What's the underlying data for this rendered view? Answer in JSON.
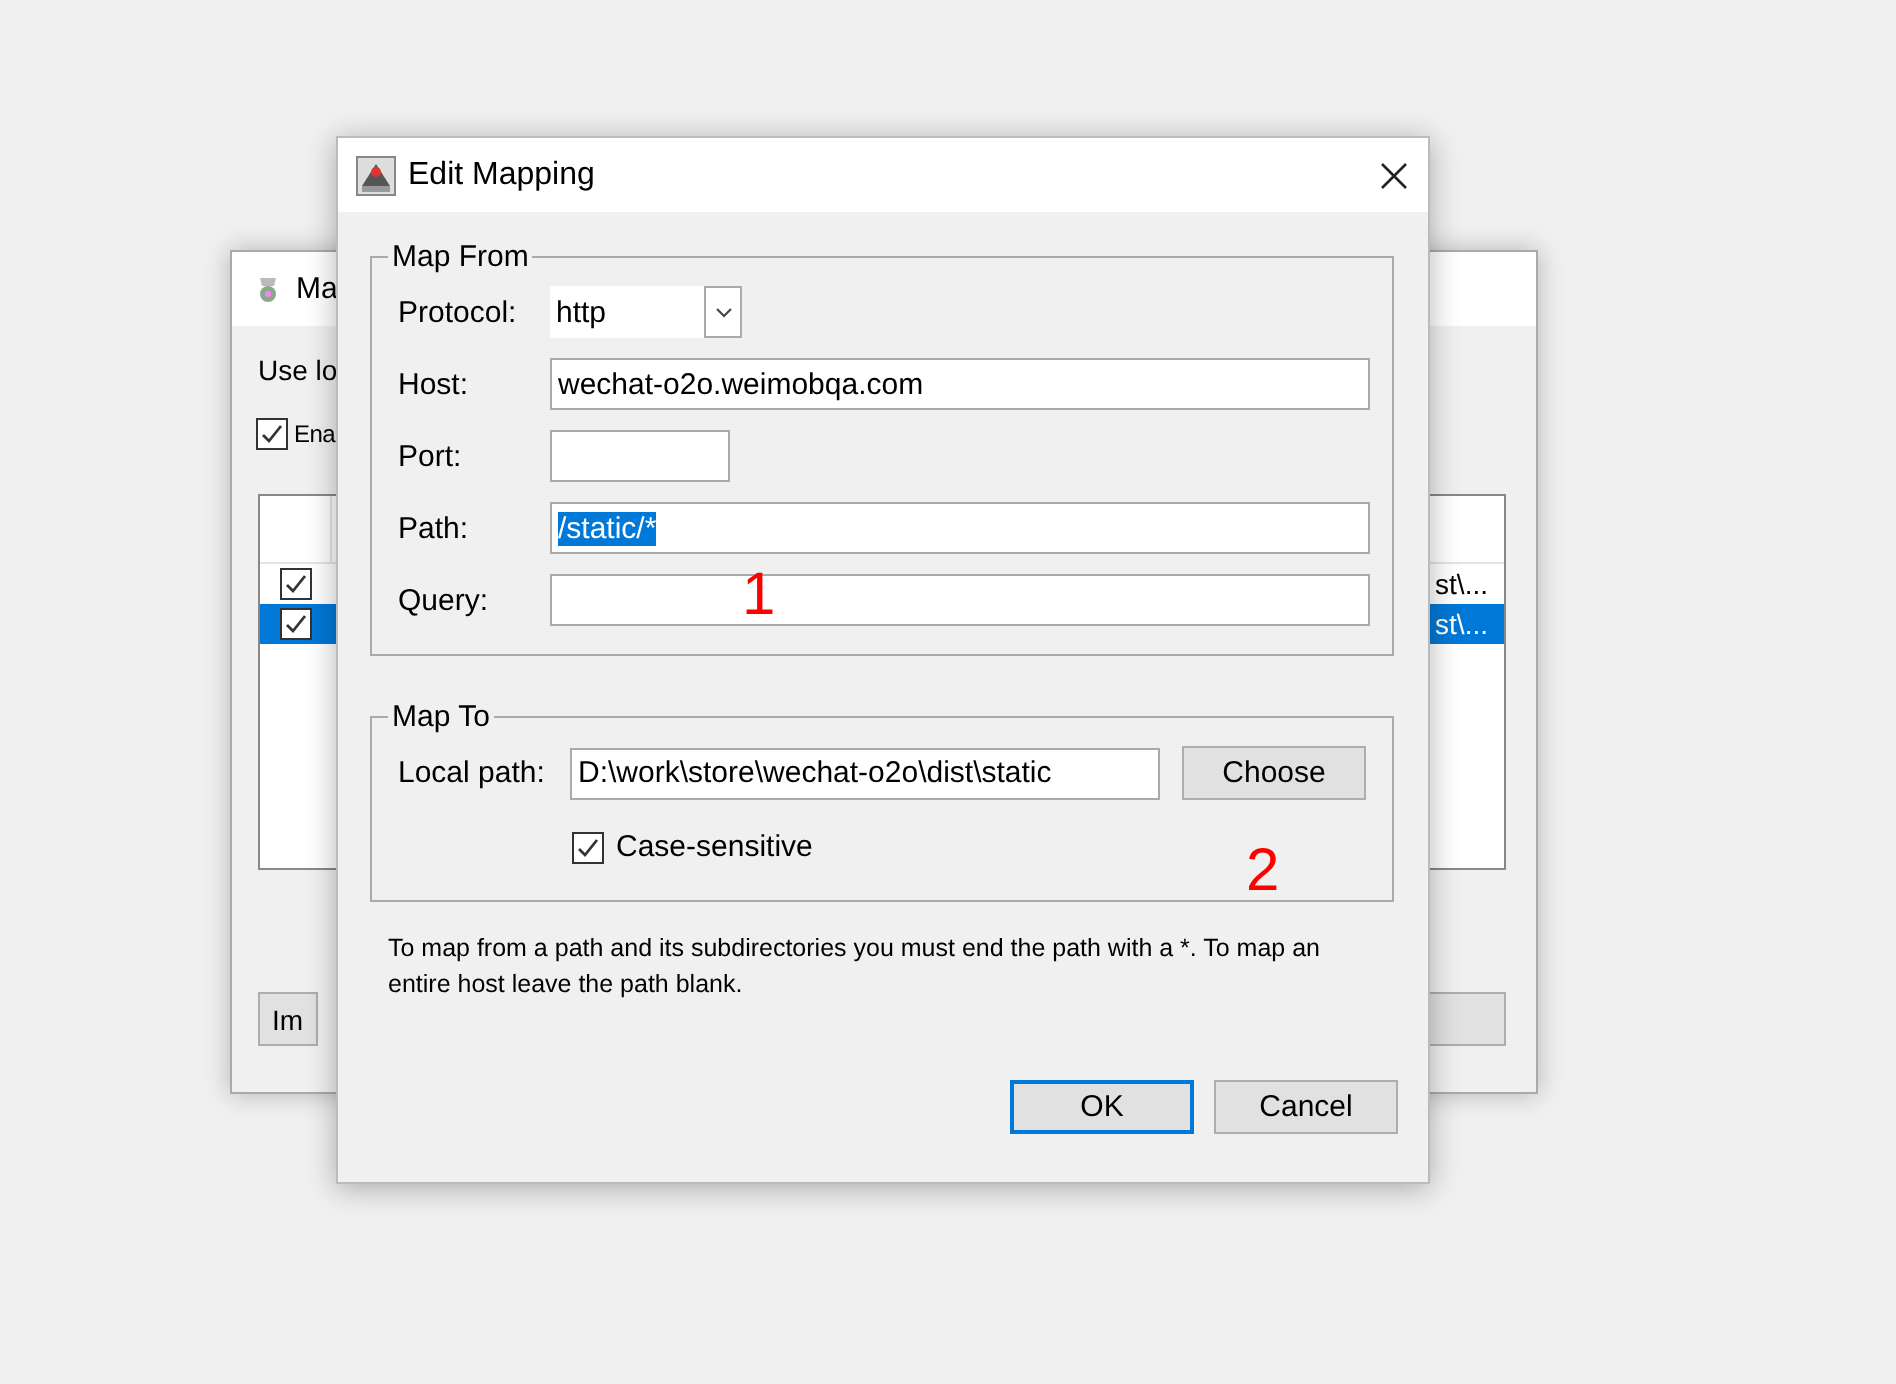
{
  "background_window": {
    "title": "Ma",
    "label": "Use lo",
    "enable": {
      "label": "Ena",
      "checked": true
    },
    "rows": [
      {
        "checked": true,
        "selected": false,
        "text": "st\\..."
      },
      {
        "checked": true,
        "selected": true,
        "text": "st\\..."
      }
    ],
    "buttons": [
      "Im"
    ]
  },
  "dialog": {
    "title": "Edit Mapping",
    "map_from": {
      "legend": "Map From",
      "fields": [
        {
          "kind": "dropdown",
          "label": "Protocol:",
          "value": "http"
        },
        {
          "kind": "text",
          "label": "Host:",
          "value": "wechat-o2o.weimobqa.com"
        },
        {
          "kind": "short",
          "label": "Port:"
        },
        {
          "kind": "text",
          "label": "Path:",
          "value": "/static/*",
          "selected": true
        },
        {
          "kind": "text",
          "label": "Query:"
        }
      ]
    },
    "map_to": {
      "legend": "Map To",
      "label": "Local path:",
      "value": "D:\\work\\store\\wechat-o2o\\dist\\static",
      "button": "Choose",
      "case_sensitive": {
        "label": "Case-sensitive",
        "checked": true
      }
    },
    "help": "To map from a path and its subdirectories you must end the path with a *. To map an entire host leave the path blank.",
    "buttons": [
      {
        "label": "OK",
        "default": true
      },
      {
        "label": "Cancel",
        "default": false
      }
    ]
  },
  "annotations": [
    {
      "text": "1"
    },
    {
      "text": "2"
    }
  ]
}
